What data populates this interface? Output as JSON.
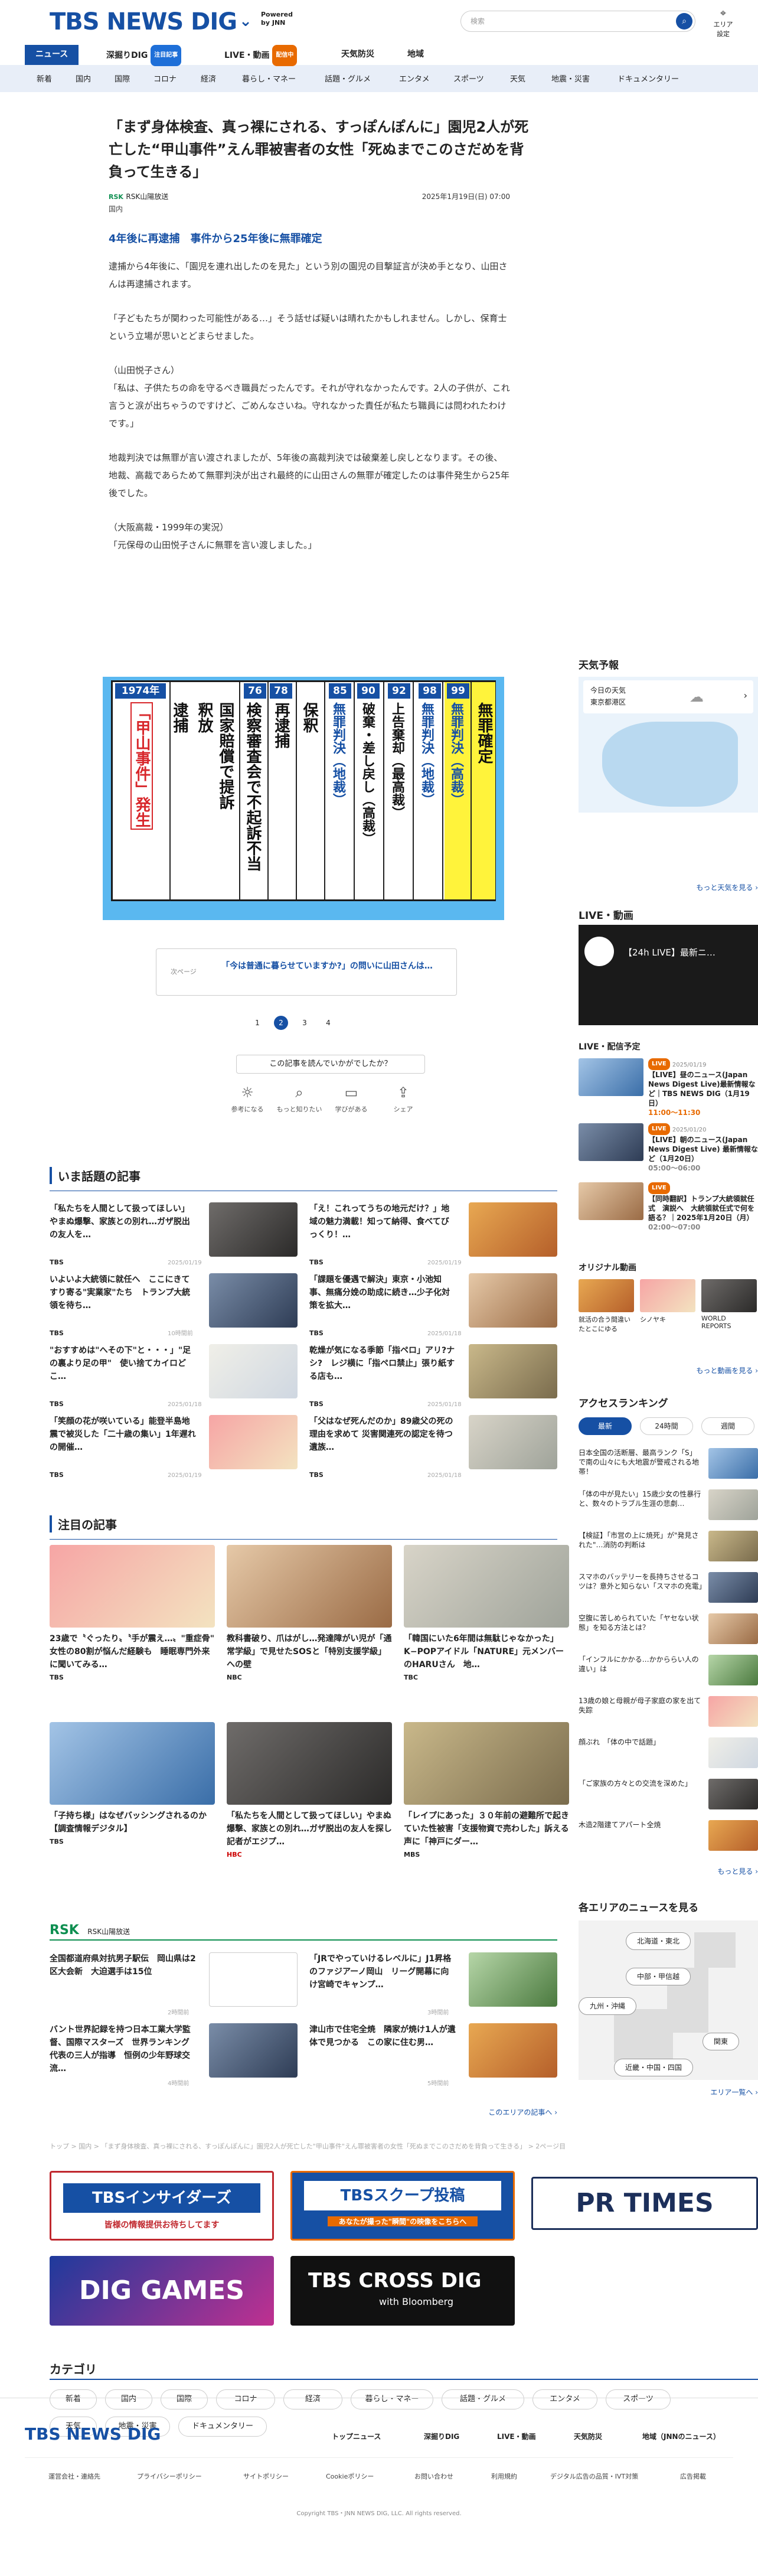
{
  "header": {
    "logo": "TBS NEWS DIG",
    "powered_line1": "Powered",
    "powered_line2": "by JNN",
    "search_placeholder": "検索",
    "area_label": "エリア設定"
  },
  "topnav": {
    "items": [
      {
        "label": "ニュース"
      },
      {
        "label": "深掘りDIG",
        "badge": "注目記事"
      },
      {
        "label": "LIVE・動画",
        "badge": "配信中"
      },
      {
        "label": "天気防災"
      },
      {
        "label": "地域"
      }
    ]
  },
  "categories": [
    "新着",
    "国内",
    "国際",
    "コロナ",
    "経済",
    "暮らし・マネー",
    "話題・グルメ",
    "エンタメ",
    "スポーツ",
    "天気",
    "地震・災害",
    "ドキュメンタリー"
  ],
  "article": {
    "title": "「まず身体検査、真っ裸にされる、すっぽんぽんに」園児2人が死亡した“甲山事件”えん罪被害者の女性「死ぬまでこのさだめを背負って生きる」",
    "source_logo": "RSK",
    "source": "RSK山陽放送",
    "date": "2025年1月19日(日) 07:00",
    "genre": "国内",
    "subhead": "4年後に再逮捕　事件から25年後に無罪確定",
    "paragraphs": [
      "逮捕から4年後に、「園児を連れ出したのを見た」という別の園児の目撃証言が決め手となり、山田さんは再逮捕されます。",
      "「子どもたちが関わった可能性がある…」そう話せば疑いは晴れたかもしれません。しかし、保育士という立場が思いとどまらせました。",
      "（山田悦子さん）\n「私は、子供たちの命を守るべき職員だったんです。それが守れなかったんです。2人の子供が、これ言うと涙が出ちゃうのですけど、ごめんなさいね。守れなかった責任が私たち職員には問われたわけです。」",
      "地裁判決では無罪が言い渡されましたが、5年後の高裁判決では破棄差し戻しとなります。その後、地裁、高裁であらためて無罪判決が出され最終的に山田さんの無罪が確定したのは事件発生から25年後でした。",
      "（大阪高裁・1999年の実況）\n「元保母の山田悦子さんに無罪を言い渡しました。」"
    ],
    "timeline": {
      "years": [
        "1974年",
        "76",
        "78",
        "85",
        "90",
        "92",
        "98",
        "99"
      ],
      "columns": [
        "「甲山事件」発生",
        "逮捕",
        "釈放",
        "国家賠償で提訴",
        "検察審査会で不起訴不当",
        "再逮捕",
        "保釈",
        "無罪判決（地裁）",
        "破棄・差し戻し（高裁）",
        "上告棄却（最高裁）",
        "無罪判決（地裁）",
        "無罪判決（高裁）",
        "無罪確定"
      ]
    },
    "next_label": "次ページ",
    "next_text": "「今は普通に暮らせていますか?」の問いに山田さんは…",
    "pages": [
      "1",
      "2",
      "3",
      "4"
    ],
    "feedback": "この記事を読んでいかがでしたか？",
    "reactions": [
      "参考になる",
      "もっと知りたい",
      "学びがある",
      "シェア"
    ]
  },
  "hot": {
    "title": "いま話題の記事",
    "items": [
      {
        "text": "「私たちを人間として扱ってほしい」やまぬ爆撃、家族との別れ…ガザ脱出の友人を…",
        "src": "TBS",
        "date": "2025/01/19"
      },
      {
        "text": "「え！これってうちの地元だけ？」地域の魅力満載！知って納得、食べてびっくり！…",
        "src": "TBS",
        "date": "2025/01/19"
      },
      {
        "text": "いよいよ大統領に就任へ　ここにきてすり寄る\"実業家\"たち　トランプ大統領を待ち…",
        "src": "TBS",
        "date": "10時間前"
      },
      {
        "text": "「課題を優遇で解決」東京・小池知事、無痛分娩の助成に続き…少子化対策を拡大…",
        "src": "TBS",
        "date": "2025/01/18"
      },
      {
        "text": "\"おすすめは\"へその下\"と・・・」\"足の裏より足の甲\"　使い捨てカイロどこ…",
        "src": "TBS",
        "date": "2025/01/18"
      },
      {
        "text": "乾燥が気になる季節「指ペロ」アリ?ナシ?　レジ横に「指ペロ禁止」張り紙する店も…",
        "src": "TBS",
        "date": "2025/01/18"
      },
      {
        "text": "「笑顔の花が咲いている」能登半島地震で被災した「二十歳の集い」1年遅れの開催…",
        "src": "TBS",
        "date": "2025/01/19"
      },
      {
        "text": "「父はなぜ死んだのか」89歳父の死の理由を求めて 災害関連死の認定を待つ遺族…",
        "src": "TBS",
        "date": "2025/01/18"
      }
    ]
  },
  "featured": {
    "title": "注目の記事",
    "items": [
      {
        "text": "23歳で〝ぐったり〟〝手が震え…〟\"重症骨\" 女性の80割が悩んだ経験も　睡眠専門外来に聞いてみる…",
        "src": "TBS",
        "date": "2025/01/19"
      },
      {
        "text": "教科書破り、爪はがし…発達障がい児が「通常学級」で見せたSOSと「特別支援学級」への壁",
        "src": "NBC",
        "date": "2025/01/19"
      },
      {
        "text": "「韓国にいた6年間は無駄じゃなかった」K−POPアイドル「NATURE」元メンバーのHARUさん　地…",
        "src": "TBC",
        "date": "2025/01/19"
      },
      {
        "text": "「子持ち様」はなぜバッシングされるのか【調査情報デジタル】",
        "src": "TBS",
        "date": "2025/01/18"
      },
      {
        "text": "「私たちを人間として扱ってほしい」やまぬ爆撃、家族との別れ…ガザ脱出の友人を探し記者がエジプ…",
        "src": "HBC",
        "date": "2025/01/18"
      },
      {
        "text": "「レイプにあった」３０年前の避難所で起きていた性被害「支援物資で売わした」訴える声に「神戸にダー…",
        "src": "MBS",
        "date": "2025/01/17"
      }
    ]
  },
  "rsk": {
    "logo": "RSK",
    "title": "RSK山陽放送",
    "items": [
      {
        "text": "全国都道府県対抗男子駅伝　岡山県は2区大会新　大迫選手は15位",
        "date": "2時間前"
      },
      {
        "text": "「JRでやっていけるレベルに」J1昇格のファジアーノ岡山　リーグ開幕に向け宮崎でキャンプ…",
        "date": "3時間前"
      },
      {
        "text": "バント世界記録を持つ日本工業大学監督、国際マスターズ　世界ランキング代表の三人が指導　恒例の少年野球交流…",
        "date": "4時間前"
      },
      {
        "text": "津山市で住宅全焼　隣家が焼け1人が遺体で見つかる　この家に住む男…",
        "date": "5時間前"
      }
    ],
    "more": "このエリアの記事へ ›"
  },
  "breadcrumb": "トップ > 国内 > 「まず身体検査、真っ裸にされる、すっぽんぽんに」園児2人が死亡した\"甲山事件\"えん罪被害者の女性「死ぬまでこのさだめを背負って生きる」 > 2ページ目",
  "banners": [
    "TBSインサイダーズ",
    "皆様の情報提供お待ちしてます",
    "TBSスクープ投稿",
    "あなたが撮った\"瞬間\"の映像をこちらへ",
    "PR TIMES",
    "DIG GAMES",
    "TBS CROSS DIG",
    "with Bloomberg"
  ],
  "catlist": {
    "title": "カテゴリ",
    "items": [
      "新着",
      "国内",
      "国際",
      "コロナ",
      "経済",
      "暮らし・マネー",
      "話題・グルメ",
      "エンタメ",
      "スポーツ",
      "天気",
      "地震・災害",
      "ドキュメンタリー"
    ]
  },
  "sidebar": {
    "weather_title": "天気予報",
    "weather_today": "今日の天気",
    "weather_place": "東京都港区",
    "weather_more": "もっと天気を見る ›",
    "live_title": "LIVE・動画",
    "live_card": "【24h LIVE】最新ニ…",
    "live_sched_title": "LIVE・配信予定",
    "lives": [
      {
        "badge": "LIVE",
        "date": "2025/01/19",
        "text": "【LIVE】昼のニュース(Japan News Digest Live)最新情報など｜TBS NEWS DIG（1月19日）",
        "time": "11:00〜11:30"
      },
      {
        "badge": "LIVE",
        "date": "2025/01/20",
        "text": "【LIVE】朝のニュース(Japan News Digest Live) 最新情報など（1月20日）",
        "time": "05:00〜06:00"
      },
      {
        "badge": "LIVE",
        "date": "",
        "text": "【同時翻訳】トランプ大統領就任式　演説へ　大統領就任式で何を語る？｜2025年1月20日（月）",
        "time": "02:00〜07:00"
      }
    ],
    "original_title": "オリジナル動画",
    "originals": [
      "就活の合う間違いたとこにゆる",
      "シノヤキ",
      "WORLD REPORTS"
    ],
    "video_more": "もっと動画を見る ›",
    "ranking_title": "アクセスランキング",
    "ranking_tabs": [
      "最新",
      "24時間",
      "週間"
    ],
    "ranking": [
      "日本全国の活断層、最高ランク「S」で南の山々にも大地震が警戒される地帯！",
      "「体の中が見たい」15歳少女の性暴行と、数々のトラブル生涯の悲劇…",
      "【検証】「市営の上に焼死」が\"発見された\"…消防の判断は",
      "スマホのバッテリーを長持ちさせるコツは？意外と知らない「スマホの充電」",
      "空腹に苦しめられていた「ヤセない状態」を知る方法とは？",
      "「インフルにかかる…かかららい人の違い」は",
      "13歳の娘と母親が母子家庭の家を出て失踪",
      "顔ぶれ　「体の中で話題」",
      "「ご家族の方々との交流を深めた」",
      "木造2階建てアパート全焼"
    ],
    "ranking_more": "もっと見る ›",
    "areas_title": "各エリアのニュースを見る",
    "areas": [
      "北海道・東北",
      "中部・甲信越",
      "九州・沖縄",
      "関東",
      "近畿・中国・四国"
    ],
    "areas_more": "エリア一覧へ ›"
  },
  "footer": {
    "logo": "TBS NEWS DIG",
    "links": [
      "トップニュース",
      "深掘りDIG",
      "LIVE・動画",
      "天気防災",
      "地域（JNNのニュース）"
    ],
    "small": [
      "運営会社・連絡先",
      "プライバシーポリシー",
      "サイトポリシー",
      "Cookieポリシー",
      "お問い合わせ",
      "利用規約",
      "デジタル広告の品質・IVT対策",
      "広告掲載"
    ],
    "copyright": "Copyright TBS・JNN NEWS DIG, LLC. All rights reserved."
  },
  "colors": {
    "brand": "#1650a4",
    "accent_orange": "#e86a00",
    "timeline_bg": "#5ab8f0",
    "highlight": "#fff33b"
  }
}
